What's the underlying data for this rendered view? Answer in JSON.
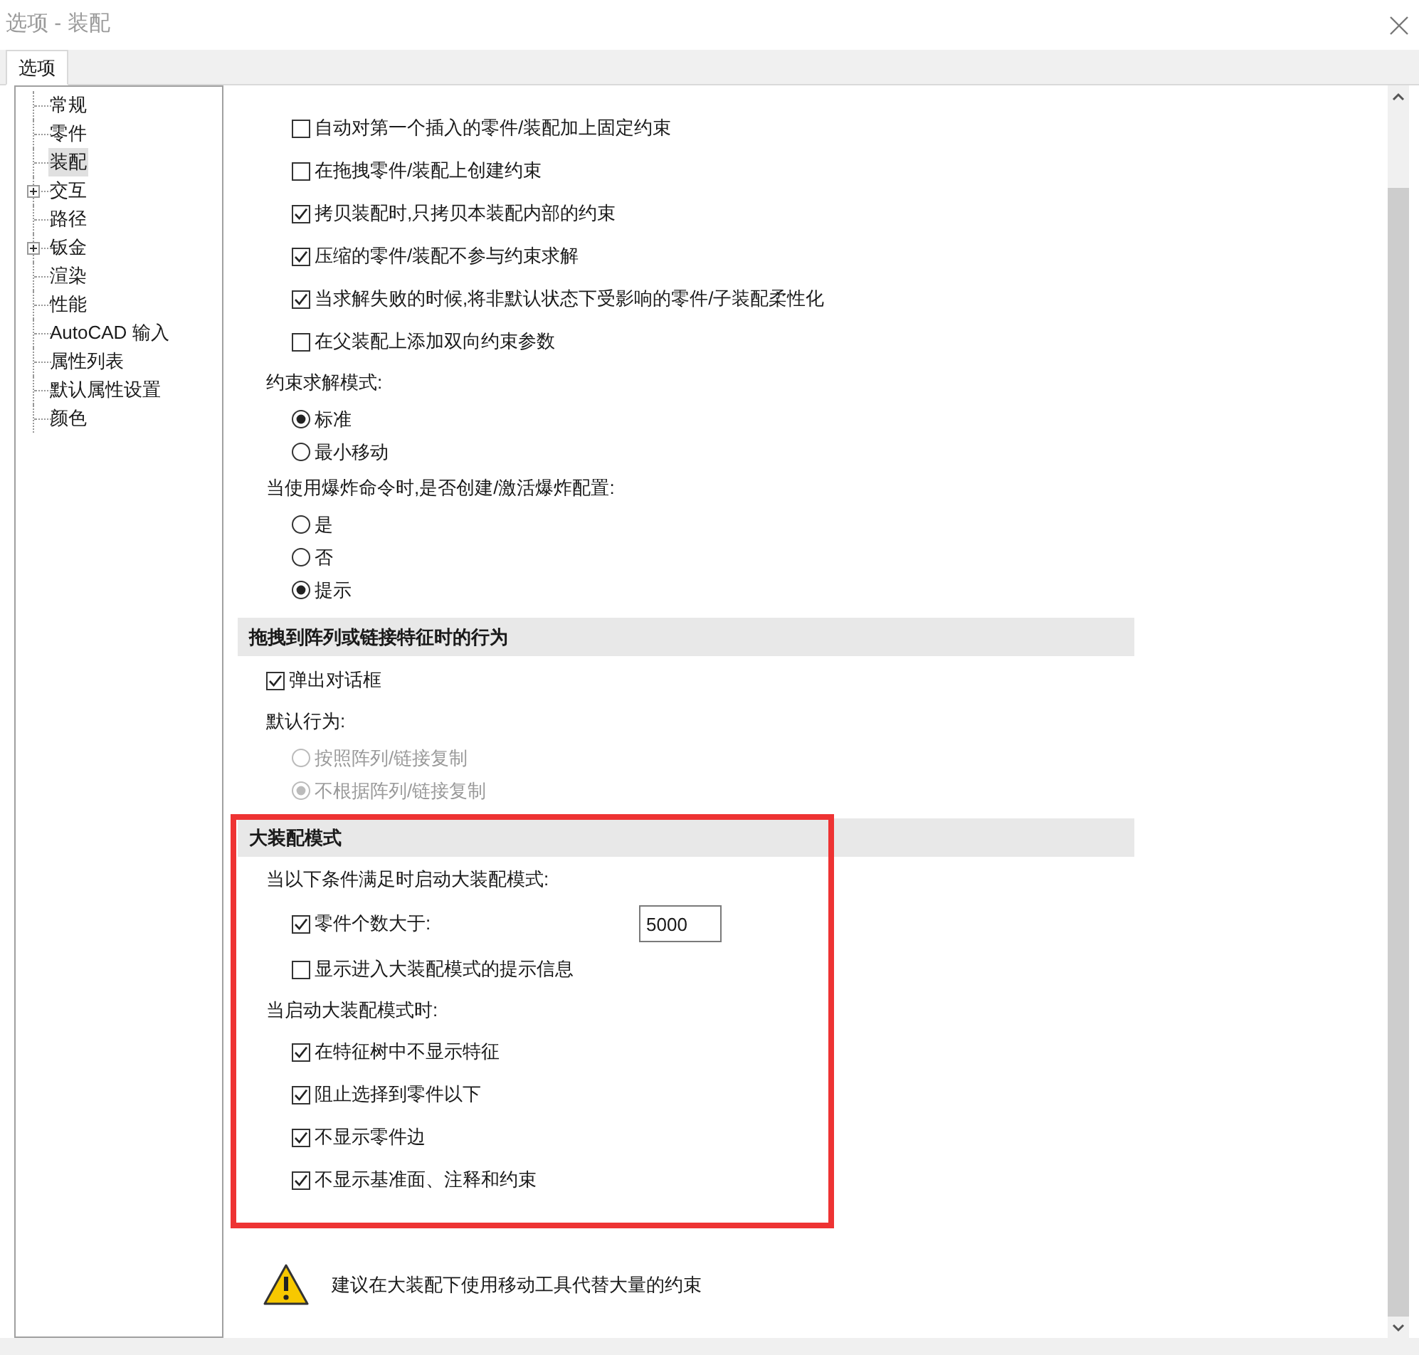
{
  "window": {
    "title": "选项 - 装配"
  },
  "tabs": [
    {
      "label": "选项",
      "selected": true
    }
  ],
  "tree": [
    {
      "label": "常规",
      "selected": false
    },
    {
      "label": "零件",
      "selected": false
    },
    {
      "label": "装配",
      "selected": true
    },
    {
      "label": "交互",
      "selected": false,
      "expanded": false
    },
    {
      "label": "路径",
      "selected": false
    },
    {
      "label": "钣金",
      "selected": false,
      "expanded": false
    },
    {
      "label": "渲染",
      "selected": false
    },
    {
      "label": "性能",
      "selected": false
    },
    {
      "label": "AutoCAD 输入",
      "selected": false
    },
    {
      "label": "属性列表",
      "selected": false
    },
    {
      "label": "默认属性设置",
      "selected": false
    },
    {
      "label": "颜色",
      "selected": false
    }
  ],
  "sections": [
    {
      "items": [
        {
          "kind": "group",
          "children": [
            {
              "kind": "checkbox",
              "label": "自动对第一个插入的零件/装配加上固定约束",
              "checked": false
            },
            {
              "kind": "checkbox",
              "label": "在拖拽零件/装配上创建约束",
              "checked": false
            },
            {
              "kind": "checkbox",
              "label": "拷贝装配时,只拷贝本装配内部的约束",
              "checked": true
            },
            {
              "kind": "checkbox",
              "label": "压缩的零件/装配不参与约束求解",
              "checked": true
            },
            {
              "kind": "checkbox",
              "label": "当求解失败的时候,将非默认状态下受影响的零件/子装配柔性化",
              "checked": true
            },
            {
              "kind": "checkbox",
              "label": "在父装配上添加双向约束参数",
              "checked": false
            }
          ]
        },
        {
          "kind": "label",
          "text": "约束求解模式:",
          "children": [
            {
              "kind": "radio",
              "label": "标准",
              "selected": true,
              "disabled": false
            },
            {
              "kind": "radio",
              "label": "最小移动",
              "selected": false,
              "disabled": false
            }
          ]
        },
        {
          "kind": "label",
          "text": "当使用爆炸命令时,是否创建/激活爆炸配置:",
          "children": [
            {
              "kind": "radio",
              "label": "是",
              "selected": false,
              "disabled": false
            },
            {
              "kind": "radio",
              "label": "否",
              "selected": false,
              "disabled": false
            },
            {
              "kind": "radio",
              "label": "提示",
              "selected": true,
              "disabled": false
            }
          ]
        }
      ]
    },
    {
      "header": "拖拽到阵列或链接特征时的行为",
      "highlighted": false,
      "items": [
        {
          "kind": "checkbox",
          "label": "弹出对话框",
          "checked": true
        },
        {
          "kind": "label",
          "text": "默认行为:",
          "children": [
            {
              "kind": "radio",
              "label": "按照阵列/链接复制",
              "selected": false,
              "disabled": true
            },
            {
              "kind": "radio",
              "label": "不根据阵列/链接复制",
              "selected": true,
              "disabled": true
            }
          ]
        }
      ]
    },
    {
      "header": "大装配模式",
      "highlighted": true,
      "items": [
        {
          "kind": "label",
          "text": "当以下条件满足时启动大装配模式:",
          "children": [
            {
              "kind": "checkbox",
              "label": "零件个数大于:",
              "checked": true,
              "value": "5000"
            },
            {
              "kind": "checkbox",
              "label": "显示进入大装配模式的提示信息",
              "checked": false
            }
          ]
        },
        {
          "kind": "label",
          "text": "当启动大装配模式时:",
          "children": [
            {
              "kind": "checkbox",
              "label": "在特征树中不显示特征",
              "checked": true
            },
            {
              "kind": "checkbox",
              "label": "阻止选择到零件以下",
              "checked": true
            },
            {
              "kind": "checkbox",
              "label": "不显示零件边",
              "checked": true
            },
            {
              "kind": "checkbox",
              "label": "不显示基准面、注释和约束",
              "checked": true
            }
          ]
        }
      ]
    }
  ],
  "notice": {
    "text": "建议在大装配下使用移动工具代替大量的约束"
  }
}
